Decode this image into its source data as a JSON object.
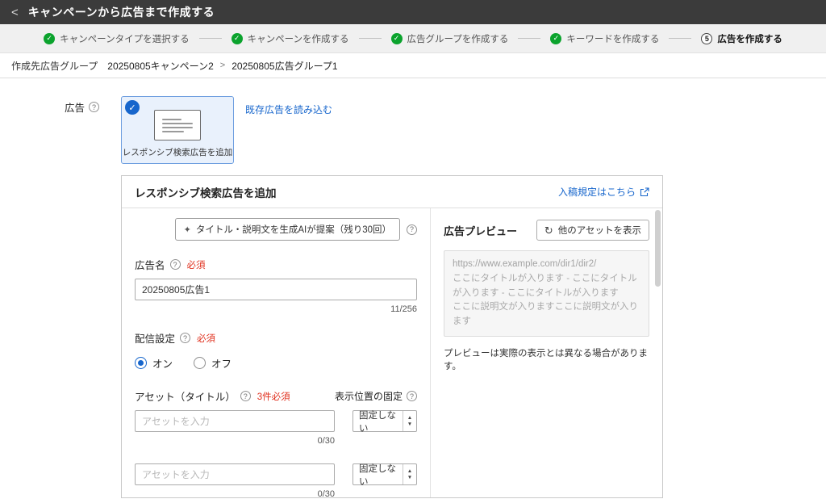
{
  "icons": {
    "back": "<",
    "check": "✓",
    "help": "?",
    "sparkle": "✦",
    "refresh": "↻",
    "select_up": "▲",
    "select_down": "▼"
  },
  "colors": {
    "accent_blue": "#1766cc",
    "success_green": "#0ba32d",
    "required_red": "#e0301e",
    "topbar_bg": "#3b3b3b",
    "selected_card_bg": "#e9f1fc"
  },
  "header": {
    "title": "キャンペーンから広告まで作成する"
  },
  "stepper": {
    "steps": [
      {
        "label": "キャンペーンタイプを選択する",
        "state": "done"
      },
      {
        "label": "キャンペーンを作成する",
        "state": "done"
      },
      {
        "label": "広告グループを作成する",
        "state": "done"
      },
      {
        "label": "キーワードを作成する",
        "state": "done"
      },
      {
        "label": "広告を作成する",
        "state": "current",
        "number": "5"
      }
    ]
  },
  "breadcrumb": {
    "prefix": "作成先広告グループ",
    "campaign": "20250805キャンペーン2",
    "separator": ">",
    "ad_group": "20250805広告グループ1"
  },
  "ad_section": {
    "label": "広告",
    "card_label": "レスポンシブ検索広告を追加",
    "existing_ad_link": "既存広告を読み込む"
  },
  "panel": {
    "title": "レスポンシブ検索広告を追加",
    "guideline_link": "入稿規定はこちら",
    "ai_button_label": "タイトル・説明文を生成AIが提案（残り30回）",
    "ad_name": {
      "label": "広告名",
      "required": "必須",
      "value": "20250805広告1",
      "counter": "11/256"
    },
    "delivery": {
      "label": "配信設定",
      "required": "必須",
      "option_on": "オン",
      "option_off": "オフ",
      "selected": "オン"
    },
    "assets": {
      "label": "アセット（タイトル）",
      "required": "3件必須",
      "position_label": "表示位置の固定",
      "rows": [
        {
          "placeholder": "アセットを入力",
          "select_value": "固定しない",
          "counter": "0/30"
        },
        {
          "placeholder": "アセットを入力",
          "select_value": "固定しない",
          "counter": "0/30"
        }
      ]
    },
    "preview": {
      "title": "広告プレビュー",
      "refresh_button": "他のアセットを表示",
      "url": "https://www.example.com/dir1/dir2/",
      "headline": "ここにタイトルが入ります - ここにタイトルが入ります - ここにタイトルが入ります",
      "description": "ここに説明文が入りますここに説明文が入ります",
      "note": "プレビューは実際の表示とは異なる場合があります。"
    }
  }
}
